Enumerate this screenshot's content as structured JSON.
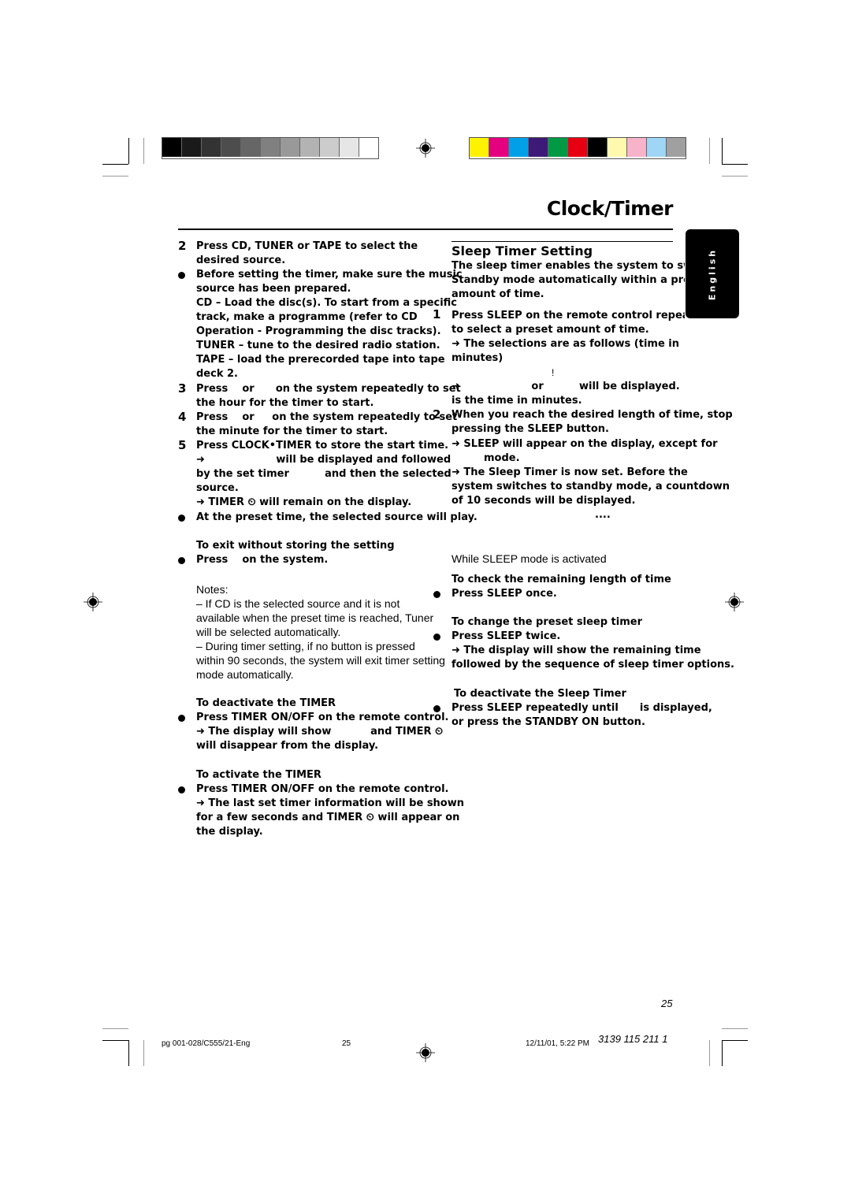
{
  "calibration": {
    "gray_swatches": [
      "#000000",
      "#1a1a1a",
      "#333333",
      "#4d4d4d",
      "#666666",
      "#808080",
      "#999999",
      "#b3b3b3",
      "#cccccc",
      "#e6e6e6",
      "#ffffff"
    ],
    "color_swatches": [
      "#fff200",
      "#e4007f",
      "#00a0e9",
      "#3e1a78",
      "#009944",
      "#e60012",
      "#000000",
      "#fff9b0",
      "#f7b3c9",
      "#9fd6f5",
      "#a0a0a0"
    ]
  },
  "page": {
    "title": "Clock/Timer",
    "language_tab": "English",
    "page_number": "25"
  },
  "left": {
    "step2": {
      "num": "2",
      "line1": "Press CD, TUNER or TAPE to select the",
      "line2": "desired source."
    },
    "prep": {
      "l1": "Before setting the timer, make sure the music",
      "l2": "source has been prepared.",
      "l3": "CD – Load the disc(s). To start from a specific",
      "l4": "track, make a programme (refer to CD",
      "l5": "Operation - Programming the disc tracks).",
      "l6": "TUNER – tune to the desired radio station.",
      "l7": "TAPE – load the prerecorded tape into tape",
      "l8": "deck 2."
    },
    "step3": {
      "num": "3",
      "line1": "Press    or      on the system repeatedly to set",
      "line2": "the hour for the timer to start."
    },
    "step4": {
      "num": "4",
      "line1": "Press    or     on the system repeatedly to set",
      "line2": "the minute for the timer to start."
    },
    "step5": {
      "num": "5",
      "line1": "Press CLOCK•TIMER to store the start time.",
      "line2": "➜                    will be displayed and followed",
      "line3": "by the set timer          and then the selected",
      "line4": "source.",
      "line5": "➜ TIMER ⏲ will remain on the display."
    },
    "preset_play": "At the preset time, the selected source will play.",
    "exit_heading": "To exit without storing the setting",
    "exit_bullet": "Press    on the system.",
    "notes": {
      "heading": "Notes:",
      "n1a": "–  If CD is the selected source and it is not",
      "n1b": "available when the preset time is reached, Tuner",
      "n1c": "will be selected automatically.",
      "n2a": "–  During timer setting, if no button is pressed",
      "n2b": "within 90 seconds, the system will exit timer setting",
      "n2c": "mode automatically."
    },
    "deactivate": {
      "heading": "To deactivate the TIMER",
      "l1": "Press TIMER ON/OFF on the remote control.",
      "l2": "➜ The display will show           and TIMER ⏲",
      "l3": "will disappear from the display."
    },
    "activate": {
      "heading": "To activate the TIMER",
      "l1": "Press TIMER ON/OFF on the remote control.",
      "l2": "➜ The last set timer information will be shown",
      "l3": "for a few seconds and TIMER ⏲ will appear on",
      "l4": "the display."
    }
  },
  "right": {
    "heading": "Sleep Timer Setting",
    "intro1": "The sleep timer enables the system to switch to",
    "intro2": "Standby mode automatically within a preset",
    "intro3": "amount of time.",
    "step1": {
      "num": "1",
      "l1": "Press SLEEP on the remote control repeatedly",
      "l2": "to select a preset amount of time.",
      "l3": "➜ The selections are as follows (time in",
      "l4": "minutes)",
      "l5": "!",
      "l6": "➜                    or          will be displayed.",
      "l7": "is the time in minutes."
    },
    "step2": {
      "num": "2",
      "l1": "When you reach the desired length of time, stop",
      "l2": "pressing the SLEEP button.",
      "l3": "➜ SLEEP will appear on the display, except for",
      "l4": "mode.",
      "l5": "➜ The Sleep Timer is now set. Before the",
      "l6": "system switches to standby mode, a countdown",
      "l7": "of 10 seconds will be displayed.",
      "l8": "...."
    },
    "while_heading": "While SLEEP mode is activated",
    "check": {
      "heading": "To check the remaining length of time",
      "bullet": "Press SLEEP once."
    },
    "change": {
      "heading": "To change the preset sleep timer",
      "bullet": "Press SLEEP twice.",
      "l2": "➜ The display will show the remaining time",
      "l3": "followed by the sequence of sleep timer options."
    },
    "deactivate": {
      "heading": "To deactivate the Sleep Timer",
      "l1": "Press SLEEP repeatedly until      is displayed,",
      "l2": "or press the STANDBY ON button."
    }
  },
  "footer": {
    "file": "pg 001-028/C555/21-Eng",
    "page": "25",
    "datetime": "12/11/01, 5:22 PM",
    "code": "3139 115 211  1"
  }
}
